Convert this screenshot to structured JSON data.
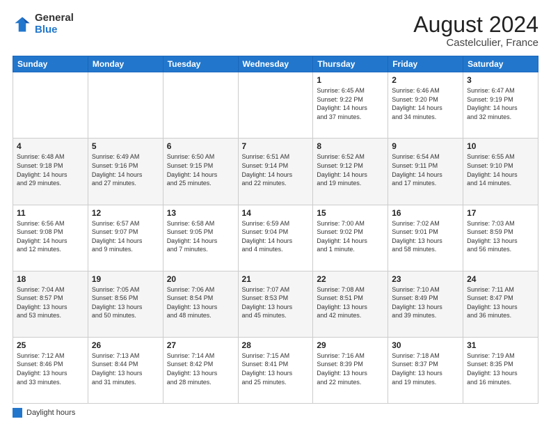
{
  "header": {
    "logo_general": "General",
    "logo_blue": "Blue",
    "month_year": "August 2024",
    "location": "Castelculier, France"
  },
  "legend": {
    "label": "Daylight hours"
  },
  "days_of_week": [
    "Sunday",
    "Monday",
    "Tuesday",
    "Wednesday",
    "Thursday",
    "Friday",
    "Saturday"
  ],
  "weeks": [
    [
      {
        "num": "",
        "info": ""
      },
      {
        "num": "",
        "info": ""
      },
      {
        "num": "",
        "info": ""
      },
      {
        "num": "",
        "info": ""
      },
      {
        "num": "1",
        "info": "Sunrise: 6:45 AM\nSunset: 9:22 PM\nDaylight: 14 hours\nand 37 minutes."
      },
      {
        "num": "2",
        "info": "Sunrise: 6:46 AM\nSunset: 9:20 PM\nDaylight: 14 hours\nand 34 minutes."
      },
      {
        "num": "3",
        "info": "Sunrise: 6:47 AM\nSunset: 9:19 PM\nDaylight: 14 hours\nand 32 minutes."
      }
    ],
    [
      {
        "num": "4",
        "info": "Sunrise: 6:48 AM\nSunset: 9:18 PM\nDaylight: 14 hours\nand 29 minutes."
      },
      {
        "num": "5",
        "info": "Sunrise: 6:49 AM\nSunset: 9:16 PM\nDaylight: 14 hours\nand 27 minutes."
      },
      {
        "num": "6",
        "info": "Sunrise: 6:50 AM\nSunset: 9:15 PM\nDaylight: 14 hours\nand 25 minutes."
      },
      {
        "num": "7",
        "info": "Sunrise: 6:51 AM\nSunset: 9:14 PM\nDaylight: 14 hours\nand 22 minutes."
      },
      {
        "num": "8",
        "info": "Sunrise: 6:52 AM\nSunset: 9:12 PM\nDaylight: 14 hours\nand 19 minutes."
      },
      {
        "num": "9",
        "info": "Sunrise: 6:54 AM\nSunset: 9:11 PM\nDaylight: 14 hours\nand 17 minutes."
      },
      {
        "num": "10",
        "info": "Sunrise: 6:55 AM\nSunset: 9:10 PM\nDaylight: 14 hours\nand 14 minutes."
      }
    ],
    [
      {
        "num": "11",
        "info": "Sunrise: 6:56 AM\nSunset: 9:08 PM\nDaylight: 14 hours\nand 12 minutes."
      },
      {
        "num": "12",
        "info": "Sunrise: 6:57 AM\nSunset: 9:07 PM\nDaylight: 14 hours\nand 9 minutes."
      },
      {
        "num": "13",
        "info": "Sunrise: 6:58 AM\nSunset: 9:05 PM\nDaylight: 14 hours\nand 7 minutes."
      },
      {
        "num": "14",
        "info": "Sunrise: 6:59 AM\nSunset: 9:04 PM\nDaylight: 14 hours\nand 4 minutes."
      },
      {
        "num": "15",
        "info": "Sunrise: 7:00 AM\nSunset: 9:02 PM\nDaylight: 14 hours\nand 1 minute."
      },
      {
        "num": "16",
        "info": "Sunrise: 7:02 AM\nSunset: 9:01 PM\nDaylight: 13 hours\nand 58 minutes."
      },
      {
        "num": "17",
        "info": "Sunrise: 7:03 AM\nSunset: 8:59 PM\nDaylight: 13 hours\nand 56 minutes."
      }
    ],
    [
      {
        "num": "18",
        "info": "Sunrise: 7:04 AM\nSunset: 8:57 PM\nDaylight: 13 hours\nand 53 minutes."
      },
      {
        "num": "19",
        "info": "Sunrise: 7:05 AM\nSunset: 8:56 PM\nDaylight: 13 hours\nand 50 minutes."
      },
      {
        "num": "20",
        "info": "Sunrise: 7:06 AM\nSunset: 8:54 PM\nDaylight: 13 hours\nand 48 minutes."
      },
      {
        "num": "21",
        "info": "Sunrise: 7:07 AM\nSunset: 8:53 PM\nDaylight: 13 hours\nand 45 minutes."
      },
      {
        "num": "22",
        "info": "Sunrise: 7:08 AM\nSunset: 8:51 PM\nDaylight: 13 hours\nand 42 minutes."
      },
      {
        "num": "23",
        "info": "Sunrise: 7:10 AM\nSunset: 8:49 PM\nDaylight: 13 hours\nand 39 minutes."
      },
      {
        "num": "24",
        "info": "Sunrise: 7:11 AM\nSunset: 8:47 PM\nDaylight: 13 hours\nand 36 minutes."
      }
    ],
    [
      {
        "num": "25",
        "info": "Sunrise: 7:12 AM\nSunset: 8:46 PM\nDaylight: 13 hours\nand 33 minutes."
      },
      {
        "num": "26",
        "info": "Sunrise: 7:13 AM\nSunset: 8:44 PM\nDaylight: 13 hours\nand 31 minutes."
      },
      {
        "num": "27",
        "info": "Sunrise: 7:14 AM\nSunset: 8:42 PM\nDaylight: 13 hours\nand 28 minutes."
      },
      {
        "num": "28",
        "info": "Sunrise: 7:15 AM\nSunset: 8:41 PM\nDaylight: 13 hours\nand 25 minutes."
      },
      {
        "num": "29",
        "info": "Sunrise: 7:16 AM\nSunset: 8:39 PM\nDaylight: 13 hours\nand 22 minutes."
      },
      {
        "num": "30",
        "info": "Sunrise: 7:18 AM\nSunset: 8:37 PM\nDaylight: 13 hours\nand 19 minutes."
      },
      {
        "num": "31",
        "info": "Sunrise: 7:19 AM\nSunset: 8:35 PM\nDaylight: 13 hours\nand 16 minutes."
      }
    ]
  ]
}
